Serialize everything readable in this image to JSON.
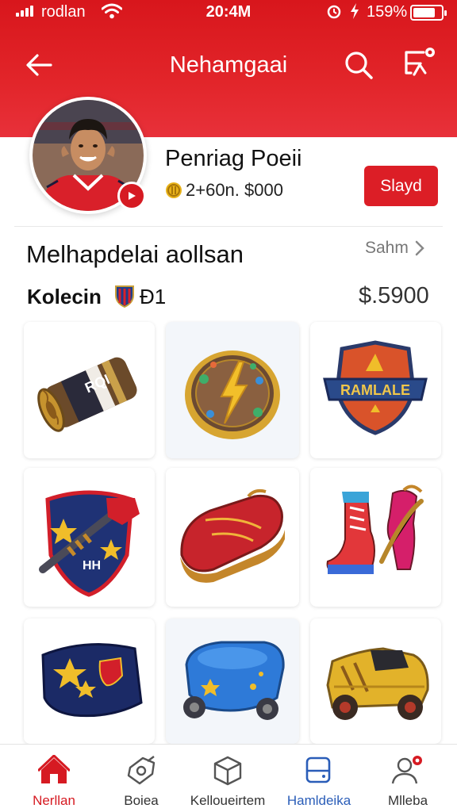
{
  "status_bar": {
    "carrier": "rodlan",
    "time": "20:4M",
    "battery_percent": "159%",
    "battery_level": 0.8
  },
  "header": {
    "title": "Nehamgaai",
    "icons": [
      "back-arrow-icon",
      "search-icon",
      "share-icon"
    ]
  },
  "profile": {
    "name": "Penriag Poeii",
    "coins": "2+60n. $000",
    "action_button": "Slayd"
  },
  "section": {
    "title": "Melhapdelai aollsan",
    "see_all": "Sahm",
    "collection_label": "Kolecin",
    "collection_num": "Ɖ1",
    "collection_value": "$.5900"
  },
  "items": [
    {
      "name": "rolled-scarf",
      "label": "RQI"
    },
    {
      "name": "lightning-medal",
      "label": ""
    },
    {
      "name": "crest-badge",
      "label": "RAMLALE"
    },
    {
      "name": "torch-shield",
      "label": ""
    },
    {
      "name": "red-boot",
      "label": ""
    },
    {
      "name": "sneaker-pair",
      "label": ""
    },
    {
      "name": "star-jersey",
      "label": ""
    },
    {
      "name": "blue-cart",
      "label": ""
    },
    {
      "name": "toy-car",
      "label": ""
    }
  ],
  "bottom_nav": [
    {
      "label": "Nerllan",
      "icon": "home-icon",
      "active": true
    },
    {
      "label": "Boiea",
      "icon": "tag-icon",
      "active": false
    },
    {
      "label": "Kelloueirtem",
      "icon": "box-icon",
      "active": false
    },
    {
      "label": "Hamldeika",
      "icon": "device-icon",
      "active": false
    },
    {
      "label": "Mlleba",
      "icon": "profile-icon",
      "active": false
    }
  ],
  "colors": {
    "brand_red": "#dc1e26",
    "active_tab": "#d61a22",
    "blue_tab": "#2a5db8"
  }
}
